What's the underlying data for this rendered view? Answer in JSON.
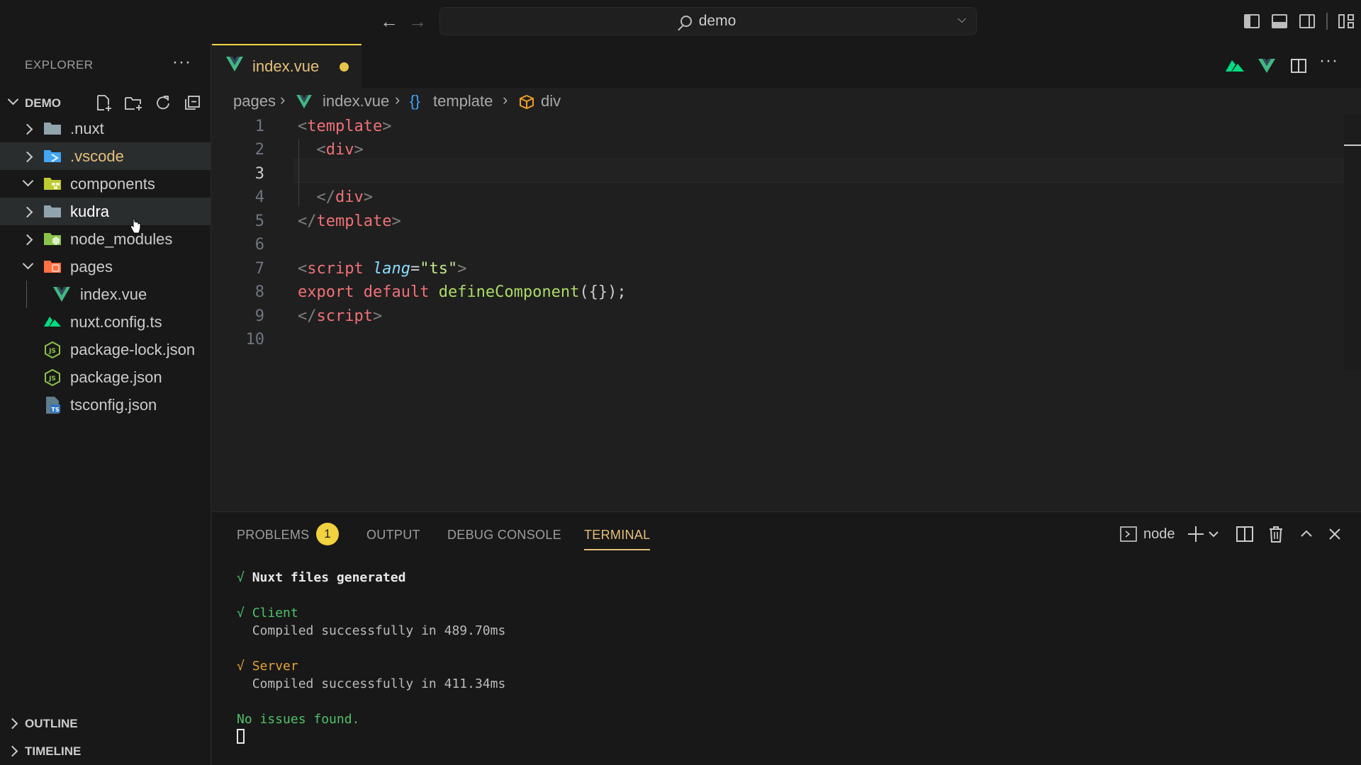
{
  "titlebar": {
    "search_text": "demo"
  },
  "explorer": {
    "title": "EXPLORER",
    "root": "DEMO",
    "items": [
      {
        "label": ".nuxt",
        "type": "folder",
        "expanded": false,
        "icon": "folder-icon",
        "color": "#90a4ae"
      },
      {
        "label": ".vscode",
        "type": "folder",
        "expanded": false,
        "icon": "vscode-folder-icon",
        "color": "#42a5f5"
      },
      {
        "label": "components",
        "type": "folder",
        "expanded": true,
        "icon": "components-folder-icon",
        "color": "#c0ca33"
      },
      {
        "label": "kudra",
        "type": "folder",
        "expanded": false,
        "icon": "folder-icon",
        "color": "#90a4ae"
      },
      {
        "label": "node_modules",
        "type": "folder",
        "expanded": false,
        "icon": "node-folder-icon",
        "color": "#8bc34a"
      },
      {
        "label": "pages",
        "type": "folder",
        "expanded": true,
        "icon": "pages-folder-icon",
        "color": "#ff7043"
      },
      {
        "label": "index.vue",
        "type": "file",
        "icon": "vue-icon",
        "color": "#41b883"
      },
      {
        "label": "nuxt.config.ts",
        "type": "file",
        "icon": "nuxt-icon",
        "color": "#00dc82"
      },
      {
        "label": "package-lock.json",
        "type": "file",
        "icon": "node-js-icon",
        "color": "#8bc34a"
      },
      {
        "label": "package.json",
        "type": "file",
        "icon": "node-js-icon",
        "color": "#8bc34a"
      },
      {
        "label": "tsconfig.json",
        "type": "file",
        "icon": "tsconfig-icon",
        "color": "#2f74c0"
      }
    ],
    "outline": "OUTLINE",
    "timeline": "TIMELINE"
  },
  "editor": {
    "tab_label": "index.vue",
    "breadcrumb": [
      "pages",
      "index.vue",
      "template",
      "div"
    ],
    "line_numbers": [
      "1",
      "2",
      "3",
      "4",
      "5",
      "6",
      "7",
      "8",
      "9",
      "10"
    ],
    "active_line": "3",
    "code": {
      "l1_tag": "template",
      "l2_tag": "div",
      "l4_tag": "div",
      "l5_tag": "template",
      "l7_tag": "script",
      "l7_attr": "lang",
      "l7_value": "\"ts\"",
      "l8_kw1": "export",
      "l8_kw2": "default",
      "l8_fn": "defineComponent",
      "l8_rest": "({});",
      "l9_tag": "script"
    }
  },
  "panel": {
    "tabs": {
      "problems": "PROBLEMS",
      "problems_count": "1",
      "output": "OUTPUT",
      "debug": "DEBUG CONSOLE",
      "terminal": "TERMINAL"
    },
    "terminal_name": "node",
    "terminal": {
      "check": "√",
      "l1": "Nuxt files generated",
      "client_title": "Client",
      "client_msg": "Compiled successfully in 489.70ms",
      "server_title": "Server",
      "server_msg": "Compiled successfully in 411.34ms",
      "final": "No issues found."
    }
  },
  "colors": {
    "accent": "#e5c07b",
    "badge": "#f2d23f",
    "success": "#4ec26a"
  }
}
